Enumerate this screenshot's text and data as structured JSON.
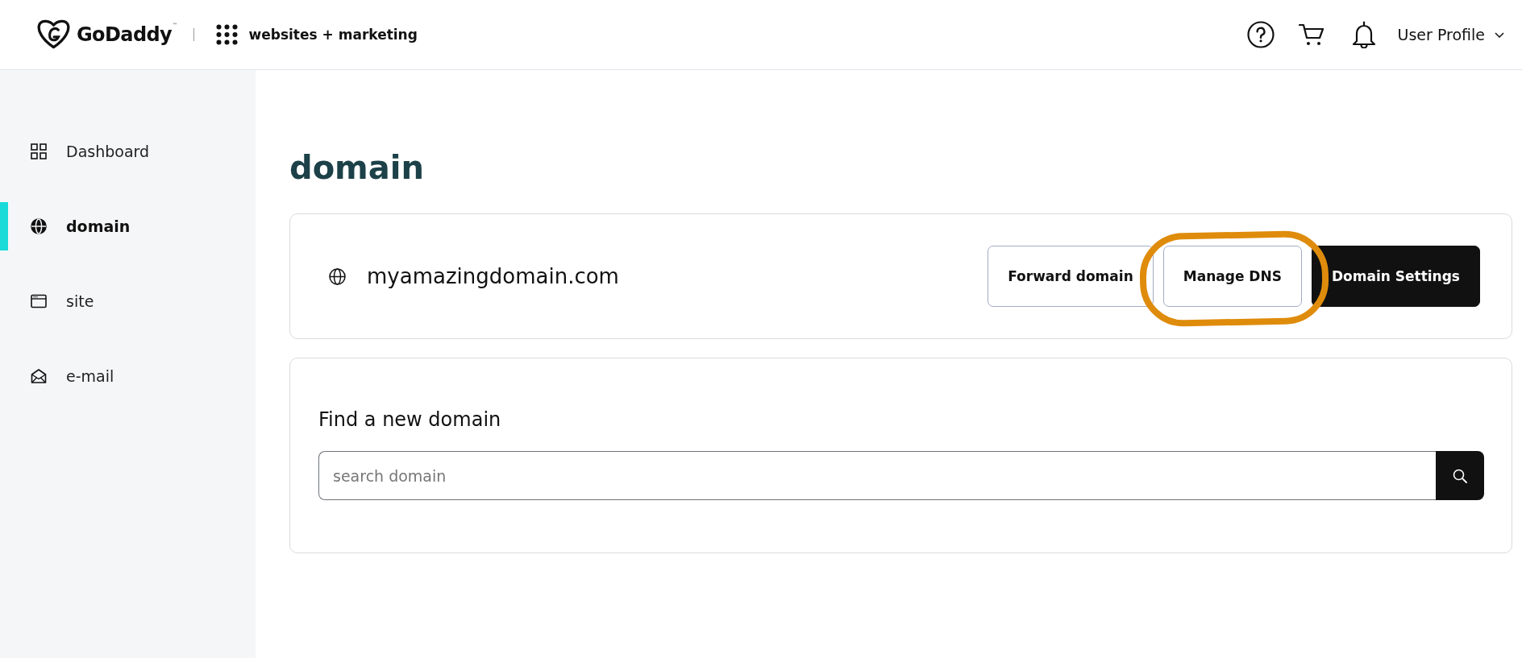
{
  "header": {
    "logo": {
      "text": "GoDaddy$^{™}$"
    },
    "product": "websites + marketing",
    "user_menu": {
      "label": "User Profile"
    }
  },
  "sidebar": {
    "items": [
      {
        "label": "Dashboard",
        "selected": false
      },
      {
        "label": "domain",
        "selected": true
      },
      {
        "label": "site",
        "selected": false
      },
      {
        "label": "e-mail",
        "selected": false
      }
    ]
  },
  "page": {
    "title": "domain"
  },
  "domain_card": {
    "domain": "myamazingdomain.com",
    "buttons": [
      {
        "label": "Forward domain",
        "kind": "outline",
        "highlighted": false
      },
      {
        "label": "Manage DNS",
        "kind": "outline",
        "highlighted": true
      },
      {
        "label": "Domain Settings",
        "kind": "primary",
        "highlighted": false
      }
    ]
  },
  "search_card": {
    "title": "Find a new domain",
    "search": {
      "placeholder": "search domain"
    }
  }
}
